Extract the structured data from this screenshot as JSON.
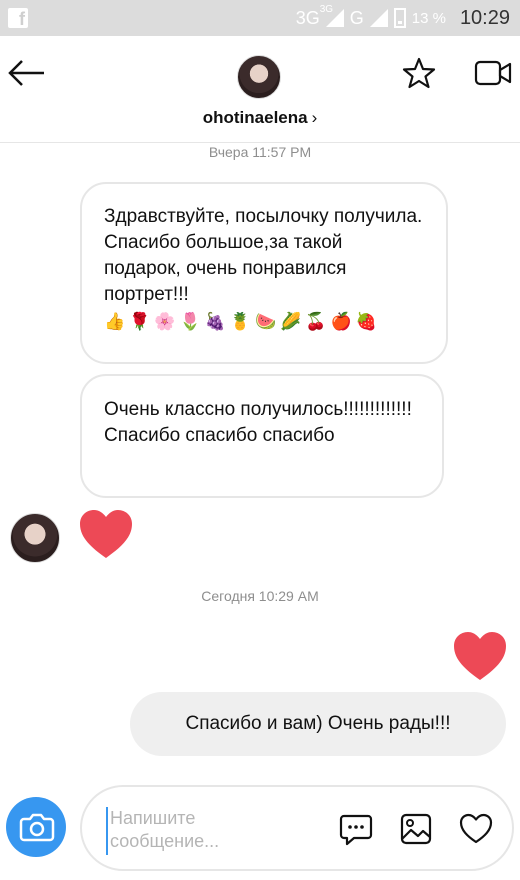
{
  "status_bar": {
    "network_1": "3G",
    "network_sup": "3G",
    "network_2": "G",
    "battery": "13 %",
    "time": "10:29"
  },
  "header": {
    "username": "ohotinaelena",
    "chevron": "›"
  },
  "messages": {
    "timestamp_1": "Вчера 11:57 PM",
    "bubble_1_text": "Здравствуйте, посылочку получила. Спасибо большое,за такой подарок, очень понравился портрет!!!",
    "bubble_1_emojis": [
      "👍",
      "🌹",
      "🌸",
      "🌷",
      "🍇",
      "🍍",
      "🍉",
      "🌽",
      "🍒",
      "🍎",
      "🍓"
    ],
    "bubble_2_text": "Очень классно получилось!!!!!!!!!!!!! Спасибо спасибо спасибо",
    "timestamp_2": "Сегодня 10:29 AM",
    "my_message": "Спасибо и вам) Очень рады!!!"
  },
  "composer": {
    "placeholder": "Напишите сообщение..."
  },
  "colors": {
    "heart": "#ed4956",
    "accent": "#3797f0"
  },
  "icons": [
    "back-arrow-icon",
    "star-icon",
    "video-camera-icon",
    "camera-icon",
    "chat-bubble-icon",
    "image-icon",
    "heart-icon"
  ]
}
